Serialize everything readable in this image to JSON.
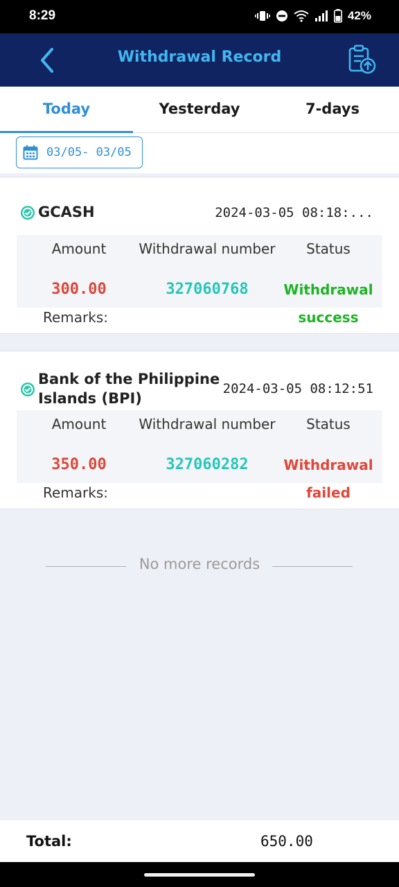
{
  "status_bar": {
    "time": "8:29",
    "battery": "42%"
  },
  "header": {
    "title": "Withdrawal Record",
    "back_icon": "chevron-left-icon",
    "record_icon": "clipboard-upload-icon"
  },
  "tabs": [
    {
      "label": "Today",
      "active": true
    },
    {
      "label": "Yesterday",
      "active": false
    },
    {
      "label": "7-days",
      "active": false
    }
  ],
  "date_filter": {
    "range": "03/05- 03/05",
    "icon": "calendar-icon"
  },
  "columns": {
    "amount": "Amount",
    "withdrawal_number": "Withdrawal number",
    "status": "Status",
    "remarks": "Remarks:"
  },
  "records": [
    {
      "bank": "GCASH",
      "time": "2024-03-05 08:18:...",
      "amount": "300.00",
      "withdrawal_number": "327060768",
      "status_line1": "Withdrawal",
      "status_line2": "success",
      "status_color": "#1fb326"
    },
    {
      "bank_line1": "Bank of the Philippine",
      "bank_line2": "Islands (BPI)",
      "time": "2024-03-05 08:12:51",
      "amount": "350.00",
      "withdrawal_number": "327060282",
      "status_line1": "Withdrawal",
      "status_line2": "failed",
      "status_color": "#e0473a"
    }
  ],
  "footer_note": "No more records",
  "total": {
    "label": "Total:",
    "value": "650.00"
  },
  "colors": {
    "header_bg": "#0f2460",
    "accent": "#2f8fd6",
    "amount": "#d9483b",
    "number": "#27c6b8"
  }
}
